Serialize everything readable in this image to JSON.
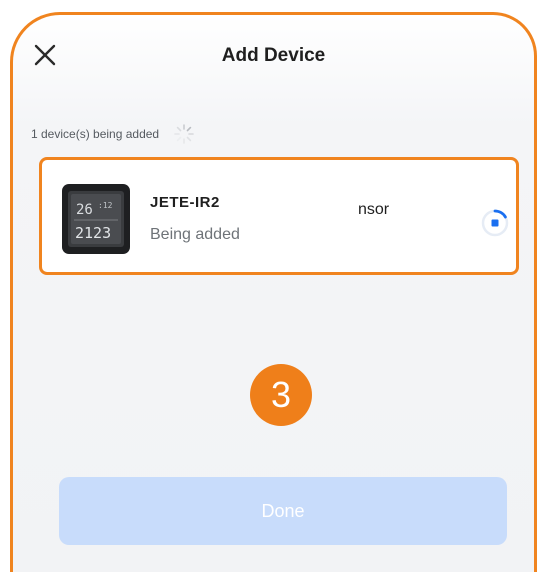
{
  "header": {
    "title": "Add Device",
    "close_icon": "close-icon"
  },
  "status": {
    "text": "1 device(s) being added",
    "icon": "spinner-icon"
  },
  "device": {
    "name": "JETE-IR2",
    "status": "Being added",
    "name_suffix": "nsor",
    "image": "thermometer-display-device",
    "progress_icon": "progress-spinner-icon"
  },
  "step_badge": {
    "number": "3",
    "color": "#ef7f1a"
  },
  "done_button": {
    "label": "Done",
    "color": "#c8dcfb"
  },
  "colors": {
    "highlight": "#f0841f",
    "accent_blue": "#1a6ff0"
  }
}
